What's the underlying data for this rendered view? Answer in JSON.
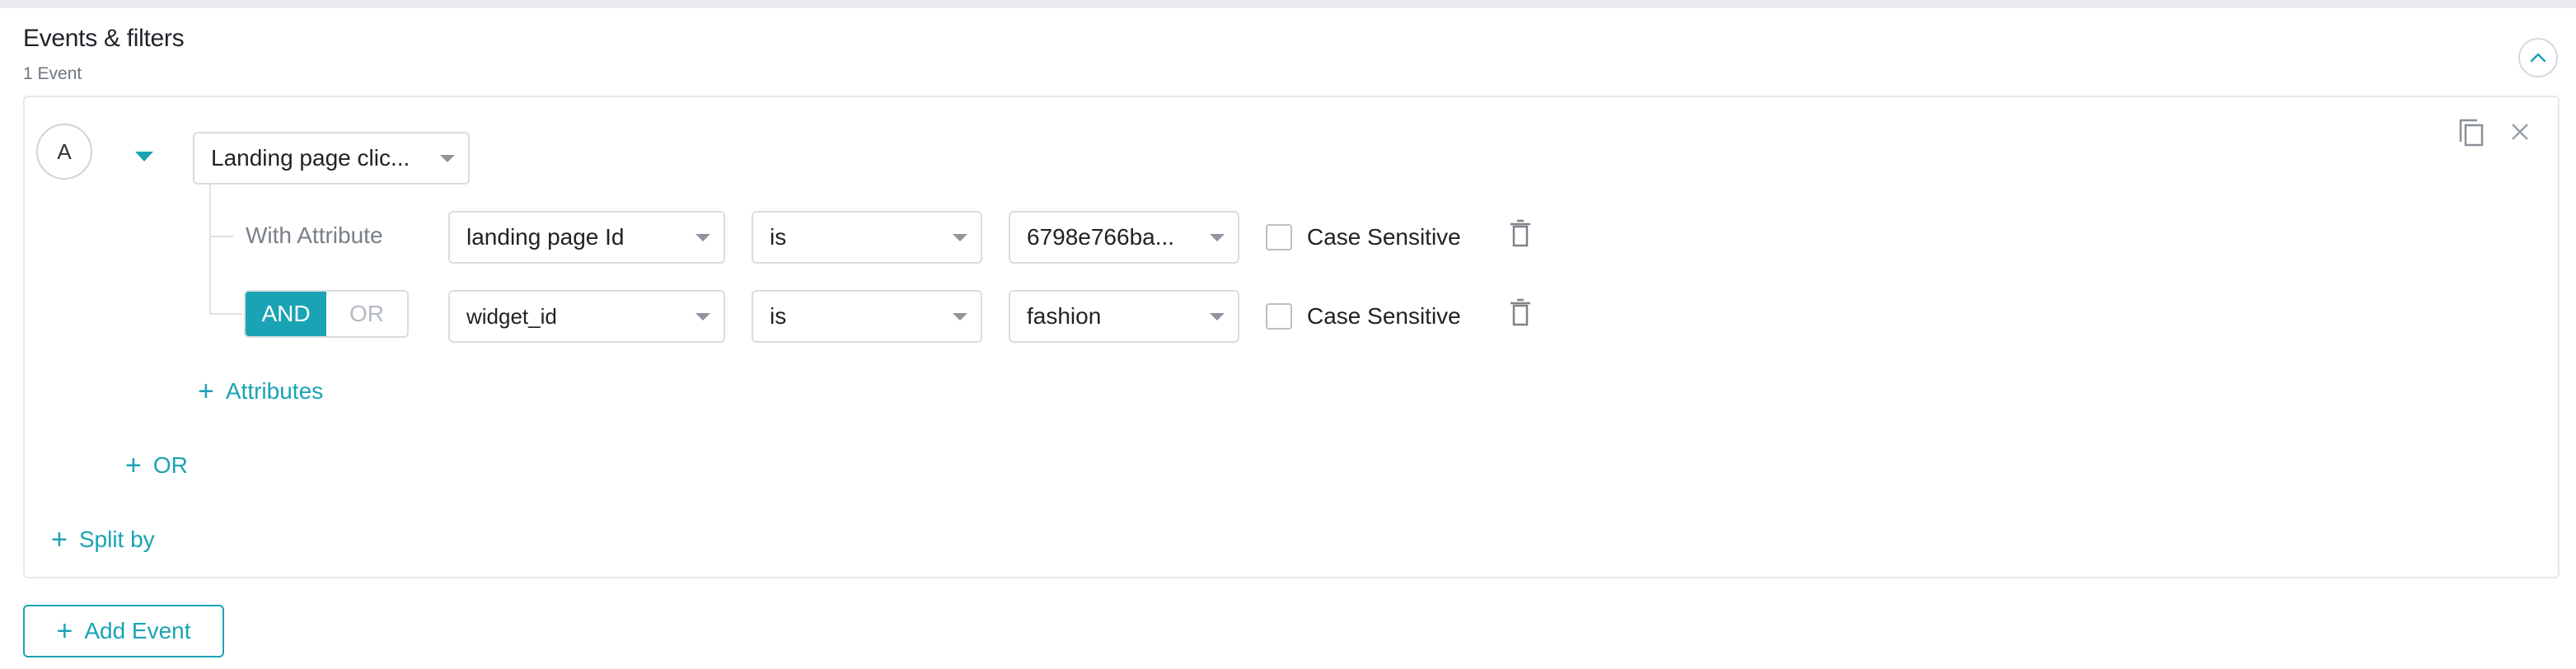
{
  "header": {
    "title": "Events & filters",
    "subtitle": "1 Event"
  },
  "event": {
    "label": "A",
    "event_name": "Landing page clic...",
    "with_attribute_label": "With Attribute",
    "conditions": [
      {
        "attribute": "landing page Id",
        "operator": "is",
        "value": "6798e766ba...",
        "case_sensitive_label": "Case Sensitive",
        "case_sensitive": false
      },
      {
        "attribute": "widget_id",
        "operator": "is",
        "value": "fashion",
        "case_sensitive_label": "Case Sensitive",
        "case_sensitive": false
      }
    ],
    "logic": {
      "and_label": "AND",
      "or_label": "OR",
      "selected": "AND"
    },
    "add_attributes_label": "Attributes",
    "add_or_label": "OR",
    "split_by_label": "Split by"
  },
  "add_event_label": "Add Event",
  "colors": {
    "accent": "#1aa3b4",
    "border": "#d9dde1",
    "muted": "#7a8088"
  }
}
